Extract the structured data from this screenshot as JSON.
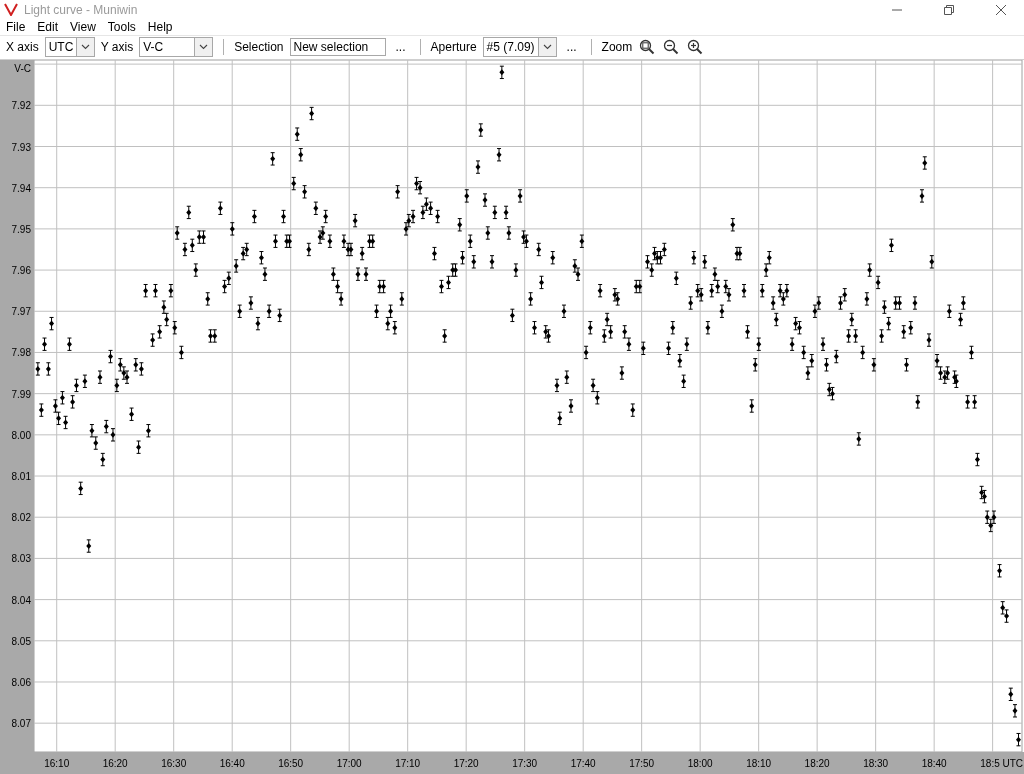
{
  "window": {
    "title": "Light curve - Muniwin"
  },
  "menu": [
    "File",
    "Edit",
    "View",
    "Tools",
    "Help"
  ],
  "toolbar": {
    "x_axis": {
      "label": "X axis",
      "value": "UTC"
    },
    "y_axis": {
      "label": "Y axis",
      "value": "V-C"
    },
    "selection": {
      "label": "Selection",
      "value": "New selection",
      "more": "..."
    },
    "aperture": {
      "label": "Aperture",
      "value": "#5 (7.09)",
      "more": "..."
    },
    "zoom": {
      "label": "Zoom"
    }
  },
  "chart": {
    "chart_data": {
      "type": "scatter",
      "xlabel": "UTC",
      "ylabel": "V-C",
      "grid": true,
      "xlim": [
        16.102,
        18.917
      ],
      "ylim": [
        8.077,
        7.909
      ],
      "xticks": [
        {
          "value": 16.1667,
          "label": "16:10"
        },
        {
          "value": 16.3333,
          "label": "16:20"
        },
        {
          "value": 16.5,
          "label": "16:30"
        },
        {
          "value": 16.6667,
          "label": "16:40"
        },
        {
          "value": 16.8333,
          "label": "16:50"
        },
        {
          "value": 17,
          "label": "17:00"
        },
        {
          "value": 17.1667,
          "label": "17:10"
        },
        {
          "value": 17.3333,
          "label": "17:20"
        },
        {
          "value": 17.5,
          "label": "17:30"
        },
        {
          "value": 17.6667,
          "label": "17:40"
        },
        {
          "value": 17.8333,
          "label": "17:50"
        },
        {
          "value": 18,
          "label": "18:00"
        },
        {
          "value": 18.1667,
          "label": "18:10"
        },
        {
          "value": 18.3333,
          "label": "18:20"
        },
        {
          "value": 18.5,
          "label": "18:30"
        },
        {
          "value": 18.6667,
          "label": "18:40"
        },
        {
          "value": 18.8333,
          "label": "18:5"
        }
      ],
      "yticks": [
        {
          "value": 7.92,
          "label": "7.92"
        },
        {
          "value": 7.93,
          "label": "7.93"
        },
        {
          "value": 7.94,
          "label": "7.94"
        },
        {
          "value": 7.95,
          "label": "7.95"
        },
        {
          "value": 7.96,
          "label": "7.96"
        },
        {
          "value": 7.97,
          "label": "7.97"
        },
        {
          "value": 7.98,
          "label": "7.98"
        },
        {
          "value": 7.99,
          "label": "7.99"
        },
        {
          "value": 8.0,
          "label": "8.00"
        },
        {
          "value": 8.01,
          "label": "8.01"
        },
        {
          "value": 8.02,
          "label": "8.02"
        },
        {
          "value": 8.03,
          "label": "8.03"
        },
        {
          "value": 8.04,
          "label": "8.04"
        },
        {
          "value": 8.05,
          "label": "8.05"
        },
        {
          "value": 8.06,
          "label": "8.06"
        },
        {
          "value": 8.07,
          "label": "8.07"
        }
      ],
      "x": [
        16.113,
        16.123,
        16.132,
        16.143,
        16.152,
        16.163,
        16.172,
        16.183,
        16.192,
        16.203,
        16.212,
        16.223,
        16.235,
        16.247,
        16.258,
        16.267,
        16.278,
        16.29,
        16.298,
        16.308,
        16.32,
        16.327,
        16.338,
        16.348,
        16.358,
        16.367,
        16.38,
        16.392,
        16.4,
        16.408,
        16.42,
        16.428,
        16.44,
        16.448,
        16.46,
        16.472,
        16.48,
        16.492,
        16.503,
        16.51,
        16.522,
        16.532,
        16.543,
        16.553,
        16.563,
        16.573,
        16.585,
        16.597,
        16.605,
        16.617,
        16.633,
        16.645,
        16.657,
        16.667,
        16.678,
        16.688,
        16.698,
        16.708,
        16.72,
        16.73,
        16.74,
        16.75,
        16.76,
        16.772,
        16.782,
        16.79,
        16.802,
        16.813,
        16.822,
        16.83,
        16.842,
        16.852,
        16.862,
        16.873,
        16.885,
        16.893,
        16.905,
        16.917,
        16.925,
        16.933,
        16.945,
        16.955,
        16.967,
        16.977,
        16.985,
        16.997,
        17.005,
        17.017,
        17.025,
        17.037,
        17.048,
        17.058,
        17.067,
        17.078,
        17.087,
        17.098,
        17.11,
        17.118,
        17.13,
        17.138,
        17.15,
        17.162,
        17.17,
        17.182,
        17.192,
        17.202,
        17.21,
        17.22,
        17.232,
        17.243,
        17.252,
        17.263,
        17.272,
        17.283,
        17.295,
        17.303,
        17.315,
        17.323,
        17.335,
        17.345,
        17.355,
        17.367,
        17.375,
        17.387,
        17.395,
        17.407,
        17.415,
        17.427,
        17.435,
        17.447,
        17.455,
        17.465,
        17.475,
        17.487,
        17.497,
        17.505,
        17.517,
        17.528,
        17.54,
        17.548,
        17.56,
        17.568,
        17.58,
        17.592,
        17.6,
        17.612,
        17.62,
        17.632,
        17.643,
        17.652,
        17.663,
        17.675,
        17.687,
        17.695,
        17.707,
        17.715,
        17.727,
        17.735,
        17.745,
        17.757,
        17.765,
        17.777,
        17.785,
        17.797,
        17.808,
        17.818,
        17.828,
        17.838,
        17.85,
        17.862,
        17.87,
        17.878,
        17.887,
        17.898,
        17.91,
        17.922,
        17.932,
        17.942,
        17.953,
        17.962,
        17.973,
        17.982,
        17.993,
        18.003,
        18.013,
        18.022,
        18.033,
        18.042,
        18.05,
        18.062,
        18.073,
        18.082,
        18.093,
        18.105,
        18.113,
        18.125,
        18.135,
        18.147,
        18.157,
        18.167,
        18.177,
        18.188,
        18.197,
        18.208,
        18.217,
        18.228,
        18.237,
        18.247,
        18.262,
        18.272,
        18.283,
        18.295,
        18.307,
        18.318,
        18.327,
        18.338,
        18.35,
        18.36,
        18.368,
        18.377,
        18.388,
        18.4,
        18.412,
        18.423,
        18.432,
        18.443,
        18.452,
        18.463,
        18.475,
        18.483,
        18.495,
        18.507,
        18.517,
        18.525,
        18.537,
        18.545,
        18.557,
        18.568,
        18.58,
        18.588,
        18.6,
        18.612,
        18.62,
        18.632,
        18.64,
        18.652,
        18.66,
        18.675,
        18.685,
        18.697,
        18.705,
        18.71,
        18.725,
        18.73,
        18.742,
        18.75,
        18.762,
        18.773,
        18.782,
        18.79,
        18.802,
        18.81,
        18.818,
        18.828,
        18.837,
        18.853,
        18.862,
        18.873,
        18.885,
        18.897,
        18.907
      ],
      "series": [
        {
          "color": "#000000",
          "errors": [
            0.0015,
            0.0015,
            0.0015,
            0.0015,
            0.0015,
            0.0015,
            0.0015,
            0.0015,
            0.0015,
            0.0015,
            0.0015,
            0.0015,
            0.0015,
            0.0015,
            0.0015,
            0.0015,
            0.0015,
            0.0015,
            0.0015,
            0.0015,
            0.0015,
            0.0015,
            0.0015,
            0.0015,
            0.0015,
            0.0015,
            0.0015,
            0.0015,
            0.0015,
            0.0015,
            0.0015,
            0.0015,
            0.0015,
            0.0015,
            0.0015,
            0.0015,
            0.0015,
            0.0015,
            0.0015,
            0.0015,
            0.0015,
            0.0015,
            0.0015,
            0.0015,
            0.0015,
            0.0015,
            0.0015,
            0.0015,
            0.0015,
            0.0015,
            0.0015,
            0.0015,
            0.0015,
            0.0015,
            0.0015,
            0.0015,
            0.0015,
            0.0015,
            0.0015,
            0.0015,
            0.0015,
            0.0015,
            0.0015,
            0.0015,
            0.0015,
            0.0015,
            0.0015,
            0.0015,
            0.0015,
            0.0015,
            0.0015,
            0.0015,
            0.0015,
            0.0015,
            0.0015,
            0.0015,
            0.0015,
            0.0015,
            0.0015,
            0.0015,
            0.0015,
            0.0015,
            0.0015,
            0.0015,
            0.0015,
            0.0015,
            0.0015,
            0.0015,
            0.0015,
            0.0015,
            0.0015,
            0.0015,
            0.0015,
            0.0015,
            0.0015,
            0.0015,
            0.0015,
            0.0015,
            0.0015,
            0.0015,
            0.0015,
            0.0015,
            0.0015,
            0.0015,
            0.0015,
            0.0015,
            0.0015,
            0.0015,
            0.0015,
            0.0015,
            0.0015,
            0.0015,
            0.0015,
            0.0015,
            0.0015,
            0.0015,
            0.0015,
            0.0015,
            0.0015,
            0.0015,
            0.0015,
            0.0015,
            0.0015,
            0.0015,
            0.0015,
            0.0015,
            0.0015,
            0.0015,
            0.0015,
            0.0015,
            0.0015,
            0.0015,
            0.0015,
            0.0015,
            0.0015,
            0.0015,
            0.0015,
            0.0015,
            0.0015,
            0.0015,
            0.0015,
            0.0015,
            0.0015,
            0.0015,
            0.0015,
            0.0015,
            0.0015,
            0.0015,
            0.0015,
            0.0015,
            0.0015,
            0.0015,
            0.0015,
            0.0015,
            0.0015,
            0.0015,
            0.0015,
            0.0015,
            0.0015,
            0.0015,
            0.0015,
            0.0015,
            0.0015,
            0.0015,
            0.0015,
            0.0015,
            0.0015,
            0.0015,
            0.0015,
            0.0015,
            0.0015,
            0.0015,
            0.0015,
            0.0015,
            0.0015,
            0.0015,
            0.0015,
            0.0015,
            0.0015,
            0.0015,
            0.0015,
            0.0015,
            0.0015,
            0.0015,
            0.0015,
            0.0015,
            0.0015,
            0.0015,
            0.0015,
            0.0015,
            0.0015,
            0.0015,
            0.0015,
            0.0015,
            0.0015,
            0.0015,
            0.0015,
            0.0015,
            0.0015,
            0.0015,
            0.0015,
            0.0015,
            0.0015,
            0.0015,
            0.0015,
            0.0015,
            0.0015,
            0.0015,
            0.0015,
            0.0015,
            0.0015,
            0.0015,
            0.0015,
            0.0015,
            0.0015,
            0.0015,
            0.0015,
            0.0015,
            0.0015,
            0.0015,
            0.0015,
            0.0015,
            0.0015,
            0.0015,
            0.0015,
            0.0015,
            0.0015,
            0.0015,
            0.0015,
            0.0015,
            0.0015,
            0.0015,
            0.0015,
            0.0015,
            0.0015,
            0.0015,
            0.0015,
            0.0015,
            0.0015,
            0.0015,
            0.0015,
            0.0015,
            0.0015,
            0.0015,
            0.0015,
            0.0015,
            0.0015,
            0.0015,
            0.0015,
            0.0015,
            0.0015,
            0.0015,
            0.0015,
            0.0015,
            0.0015,
            0.0015,
            0.0015,
            0.0015,
            0.0015,
            0.0015,
            0.0015,
            0.0015,
            0.0015,
            0.0015,
            0.0015,
            0.0015,
            0.0015,
            0.0015,
            0.0015,
            0.0015,
            0.0015
          ],
          "values": [
            7.984,
            7.994,
            7.978,
            7.984,
            7.973,
            7.993,
            7.996,
            7.991,
            7.997,
            7.978,
            7.992,
            7.988,
            8.013,
            7.987,
            8.027,
            7.999,
            8.002,
            7.986,
            8.006,
            7.998,
            7.981,
            8.0,
            7.988,
            7.983,
            7.985,
            7.986,
            7.995,
            7.983,
            8.003,
            7.984,
            7.965,
            7.999,
            7.977,
            7.965,
            7.975,
            7.969,
            7.972,
            7.965,
            7.974,
            7.951,
            7.98,
            7.955,
            7.946,
            7.954,
            7.96,
            7.952,
            7.952,
            7.967,
            7.976,
            7.976,
            7.945,
            7.964,
            7.962,
            7.95,
            7.959,
            7.97,
            7.956,
            7.955,
            7.968,
            7.947,
            7.973,
            7.957,
            7.961,
            7.97,
            7.933,
            7.953,
            7.971,
            7.947,
            7.953,
            7.953,
            7.939,
            7.927,
            7.932,
            7.941,
            7.955,
            7.922,
            7.945,
            7.952,
            7.951,
            7.947,
            7.953,
            7.961,
            7.964,
            7.967,
            7.953,
            7.955,
            7.955,
            7.948,
            7.961,
            7.956,
            7.961,
            7.953,
            7.953,
            7.97,
            7.964,
            7.964,
            7.973,
            7.97,
            7.974,
            7.941,
            7.967,
            7.95,
            7.948,
            7.947,
            7.939,
            7.94,
            7.946,
            7.944,
            7.945,
            7.956,
            7.947,
            7.964,
            7.976,
            7.963,
            7.96,
            7.96,
            7.949,
            7.957,
            7.942,
            7.953,
            7.958,
            7.935,
            7.926,
            7.943,
            7.951,
            7.958,
            7.946,
            7.932,
            7.912,
            7.946,
            7.951,
            7.971,
            7.96,
            7.942,
            7.952,
            7.953,
            7.967,
            7.974,
            7.955,
            7.963,
            7.975,
            7.976,
            7.957,
            7.988,
            7.996,
            7.97,
            7.986,
            7.993,
            7.959,
            7.961,
            7.953,
            7.98,
            7.974,
            7.988,
            7.991,
            7.965,
            7.976,
            7.972,
            7.975,
            7.966,
            7.967,
            7.985,
            7.975,
            7.978,
            7.994,
            7.964,
            7.964,
            7.979,
            7.958,
            7.96,
            7.956,
            7.957,
            7.957,
            7.955,
            7.979,
            7.974,
            7.962,
            7.982,
            7.987,
            7.978,
            7.968,
            7.957,
            7.965,
            7.966,
            7.958,
            7.974,
            7.965,
            7.961,
            7.964,
            7.97,
            7.964,
            7.966,
            7.949,
            7.956,
            7.956,
            7.965,
            7.975,
            7.993,
            7.983,
            7.978,
            7.965,
            7.96,
            7.957,
            7.968,
            7.972,
            7.965,
            7.967,
            7.965,
            7.978,
            7.973,
            7.974,
            7.98,
            7.985,
            7.982,
            7.97,
            7.968,
            7.978,
            7.983,
            7.989,
            7.99,
            7.981,
            7.968,
            7.966,
            7.976,
            7.972,
            7.976,
            8.001,
            7.98,
            7.967,
            7.96,
            7.983,
            7.963,
            7.976,
            7.969,
            7.973,
            7.954,
            7.968,
            7.968,
            7.975,
            7.983,
            7.974,
            7.968,
            7.992,
            7.942,
            7.934,
            7.977,
            7.958,
            7.982,
            7.985,
            7.986,
            7.985,
            7.97,
            7.986,
            7.987,
            7.972,
            7.968,
            7.992,
            7.98,
            7.992,
            8.006,
            8.014,
            8.015,
            8.02,
            8.022,
            8.02,
            8.033,
            8.042,
            8.044,
            8.063,
            8.067,
            8.074
          ]
        }
      ]
    }
  }
}
